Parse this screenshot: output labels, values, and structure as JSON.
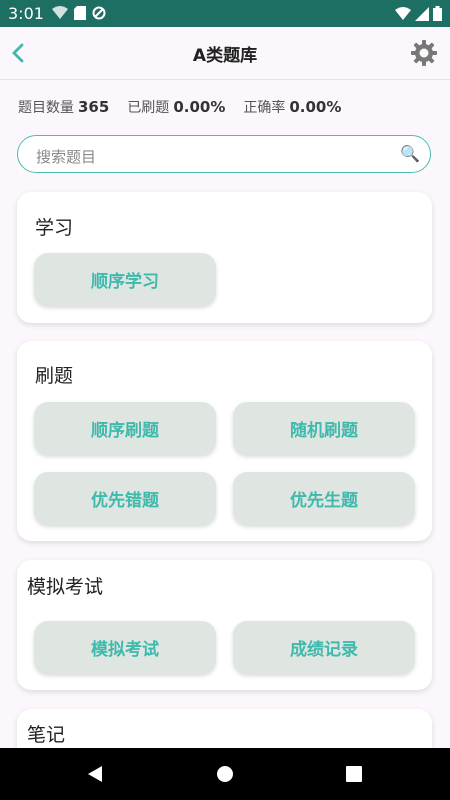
{
  "status_bar": {
    "time": "3:01"
  },
  "app_bar": {
    "title": "A类题库"
  },
  "stats": {
    "count_label": "题目数量",
    "count_value": "365",
    "done_label": "已刷题",
    "done_value": "0.00%",
    "accuracy_label": "正确率",
    "accuracy_value": "0.00%"
  },
  "search": {
    "placeholder": "搜索题目"
  },
  "sections": {
    "study": {
      "title": "学习",
      "buttons": [
        "顺序学习"
      ]
    },
    "practice": {
      "title": "刷题",
      "buttons": [
        "顺序刷题",
        "随机刷题",
        "优先错题",
        "优先生题"
      ]
    },
    "exam": {
      "title": "模拟考试",
      "buttons": [
        "模拟考试",
        "成绩记录"
      ]
    },
    "notes": {
      "title": "笔记"
    }
  },
  "colors": {
    "primary": "#1d6e63",
    "accent": "#3fb9ac"
  },
  "icons": [
    "back-arrow-icon",
    "gear-icon",
    "search-icon"
  ]
}
